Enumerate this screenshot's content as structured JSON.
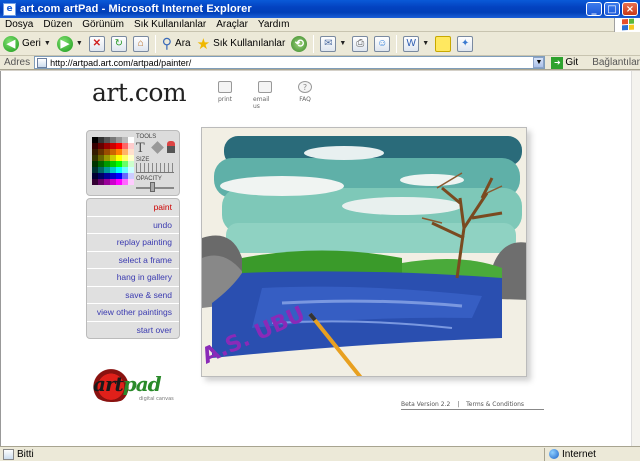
{
  "window": {
    "title": "art.com artPad - Microsoft Internet Explorer"
  },
  "menu": {
    "items": [
      "Dosya",
      "Düzen",
      "Görünüm",
      "Sık Kullanılanlar",
      "Araçlar",
      "Yardım"
    ]
  },
  "toolbar": {
    "back_label": "Geri",
    "search_label": "Ara",
    "favorites_label": "Sık Kullanılanlar"
  },
  "address": {
    "label": "Adres",
    "url": "http://artpad.art.com/artpad/painter/",
    "go_label": "Git",
    "links_label": "Bağlantılar"
  },
  "page": {
    "logo": "art.com",
    "top_links": [
      "print",
      "email us",
      "FAQ"
    ],
    "tools": {
      "tools_label": "TOOLS",
      "tool_t": "T",
      "size_label": "SIZE",
      "opacity_label": "OPACITY"
    },
    "nav": [
      "paint",
      "undo",
      "replay painting",
      "select a frame",
      "hang in gallery",
      "save & send",
      "view other paintings",
      "start over"
    ],
    "artpad_logo": {
      "art": "art",
      "pad": "pad",
      "tag": "digital canvas"
    },
    "painting_signature": "A.S. UBU",
    "footer": {
      "version": "Beta Version 2.2",
      "sep": "|",
      "terms": "Terms & Conditions"
    }
  },
  "palette_colors": [
    "#000000",
    "#333333",
    "#555555",
    "#777777",
    "#999999",
    "#bbbbbb",
    "#ffffff",
    "#330000",
    "#660000",
    "#990000",
    "#cc0000",
    "#ff0000",
    "#ff6666",
    "#ffcccc",
    "#331a00",
    "#663300",
    "#994d00",
    "#cc6600",
    "#ff8000",
    "#ffb366",
    "#ffe0cc",
    "#333300",
    "#666600",
    "#999900",
    "#cccc00",
    "#ffff00",
    "#ffff66",
    "#ffffcc",
    "#003300",
    "#006600",
    "#009900",
    "#00cc00",
    "#00ff00",
    "#66ff66",
    "#ccffcc",
    "#003333",
    "#006666",
    "#009999",
    "#00cccc",
    "#00ffff",
    "#66ffff",
    "#ccffff",
    "#000033",
    "#000066",
    "#000099",
    "#0000cc",
    "#0000ff",
    "#6666ff",
    "#ccccff",
    "#330033",
    "#660066",
    "#990099",
    "#cc00cc",
    "#ff00ff",
    "#ff66ff",
    "#ffccff"
  ],
  "status": {
    "text": "Bitti",
    "zone": "Internet"
  }
}
